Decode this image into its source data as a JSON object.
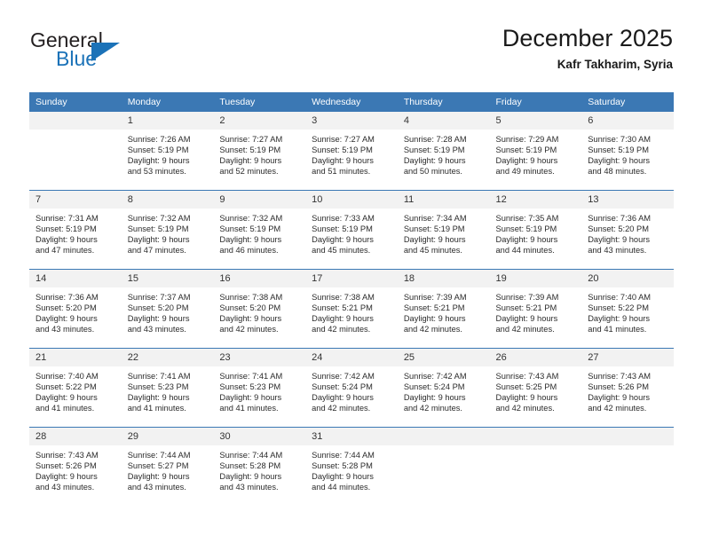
{
  "brand": {
    "name_top": "General",
    "name_bottom": "Blue",
    "accent_color": "#1b72b8",
    "triangle_icon": "triangle-icon"
  },
  "header": {
    "title": "December 2025",
    "subtitle": "Kafr Takharim, Syria"
  },
  "calendar": {
    "header_bg": "#3b78b4",
    "daynum_bg": "#f2f2f2",
    "weekdays": [
      "Sunday",
      "Monday",
      "Tuesday",
      "Wednesday",
      "Thursday",
      "Friday",
      "Saturday"
    ],
    "weeks": [
      [
        {
          "day": "",
          "blank": true,
          "sunrise": "",
          "sunset": "",
          "daylight1": "",
          "daylight2": ""
        },
        {
          "day": "1",
          "sunrise": "Sunrise: 7:26 AM",
          "sunset": "Sunset: 5:19 PM",
          "daylight1": "Daylight: 9 hours",
          "daylight2": "and 53 minutes."
        },
        {
          "day": "2",
          "sunrise": "Sunrise: 7:27 AM",
          "sunset": "Sunset: 5:19 PM",
          "daylight1": "Daylight: 9 hours",
          "daylight2": "and 52 minutes."
        },
        {
          "day": "3",
          "sunrise": "Sunrise: 7:27 AM",
          "sunset": "Sunset: 5:19 PM",
          "daylight1": "Daylight: 9 hours",
          "daylight2": "and 51 minutes."
        },
        {
          "day": "4",
          "sunrise": "Sunrise: 7:28 AM",
          "sunset": "Sunset: 5:19 PM",
          "daylight1": "Daylight: 9 hours",
          "daylight2": "and 50 minutes."
        },
        {
          "day": "5",
          "sunrise": "Sunrise: 7:29 AM",
          "sunset": "Sunset: 5:19 PM",
          "daylight1": "Daylight: 9 hours",
          "daylight2": "and 49 minutes."
        },
        {
          "day": "6",
          "sunrise": "Sunrise: 7:30 AM",
          "sunset": "Sunset: 5:19 PM",
          "daylight1": "Daylight: 9 hours",
          "daylight2": "and 48 minutes."
        }
      ],
      [
        {
          "day": "7",
          "sunrise": "Sunrise: 7:31 AM",
          "sunset": "Sunset: 5:19 PM",
          "daylight1": "Daylight: 9 hours",
          "daylight2": "and 47 minutes."
        },
        {
          "day": "8",
          "sunrise": "Sunrise: 7:32 AM",
          "sunset": "Sunset: 5:19 PM",
          "daylight1": "Daylight: 9 hours",
          "daylight2": "and 47 minutes."
        },
        {
          "day": "9",
          "sunrise": "Sunrise: 7:32 AM",
          "sunset": "Sunset: 5:19 PM",
          "daylight1": "Daylight: 9 hours",
          "daylight2": "and 46 minutes."
        },
        {
          "day": "10",
          "sunrise": "Sunrise: 7:33 AM",
          "sunset": "Sunset: 5:19 PM",
          "daylight1": "Daylight: 9 hours",
          "daylight2": "and 45 minutes."
        },
        {
          "day": "11",
          "sunrise": "Sunrise: 7:34 AM",
          "sunset": "Sunset: 5:19 PM",
          "daylight1": "Daylight: 9 hours",
          "daylight2": "and 45 minutes."
        },
        {
          "day": "12",
          "sunrise": "Sunrise: 7:35 AM",
          "sunset": "Sunset: 5:19 PM",
          "daylight1": "Daylight: 9 hours",
          "daylight2": "and 44 minutes."
        },
        {
          "day": "13",
          "sunrise": "Sunrise: 7:36 AM",
          "sunset": "Sunset: 5:20 PM",
          "daylight1": "Daylight: 9 hours",
          "daylight2": "and 43 minutes."
        }
      ],
      [
        {
          "day": "14",
          "sunrise": "Sunrise: 7:36 AM",
          "sunset": "Sunset: 5:20 PM",
          "daylight1": "Daylight: 9 hours",
          "daylight2": "and 43 minutes."
        },
        {
          "day": "15",
          "sunrise": "Sunrise: 7:37 AM",
          "sunset": "Sunset: 5:20 PM",
          "daylight1": "Daylight: 9 hours",
          "daylight2": "and 43 minutes."
        },
        {
          "day": "16",
          "sunrise": "Sunrise: 7:38 AM",
          "sunset": "Sunset: 5:20 PM",
          "daylight1": "Daylight: 9 hours",
          "daylight2": "and 42 minutes."
        },
        {
          "day": "17",
          "sunrise": "Sunrise: 7:38 AM",
          "sunset": "Sunset: 5:21 PM",
          "daylight1": "Daylight: 9 hours",
          "daylight2": "and 42 minutes."
        },
        {
          "day": "18",
          "sunrise": "Sunrise: 7:39 AM",
          "sunset": "Sunset: 5:21 PM",
          "daylight1": "Daylight: 9 hours",
          "daylight2": "and 42 minutes."
        },
        {
          "day": "19",
          "sunrise": "Sunrise: 7:39 AM",
          "sunset": "Sunset: 5:21 PM",
          "daylight1": "Daylight: 9 hours",
          "daylight2": "and 42 minutes."
        },
        {
          "day": "20",
          "sunrise": "Sunrise: 7:40 AM",
          "sunset": "Sunset: 5:22 PM",
          "daylight1": "Daylight: 9 hours",
          "daylight2": "and 41 minutes."
        }
      ],
      [
        {
          "day": "21",
          "sunrise": "Sunrise: 7:40 AM",
          "sunset": "Sunset: 5:22 PM",
          "daylight1": "Daylight: 9 hours",
          "daylight2": "and 41 minutes."
        },
        {
          "day": "22",
          "sunrise": "Sunrise: 7:41 AM",
          "sunset": "Sunset: 5:23 PM",
          "daylight1": "Daylight: 9 hours",
          "daylight2": "and 41 minutes."
        },
        {
          "day": "23",
          "sunrise": "Sunrise: 7:41 AM",
          "sunset": "Sunset: 5:23 PM",
          "daylight1": "Daylight: 9 hours",
          "daylight2": "and 41 minutes."
        },
        {
          "day": "24",
          "sunrise": "Sunrise: 7:42 AM",
          "sunset": "Sunset: 5:24 PM",
          "daylight1": "Daylight: 9 hours",
          "daylight2": "and 42 minutes."
        },
        {
          "day": "25",
          "sunrise": "Sunrise: 7:42 AM",
          "sunset": "Sunset: 5:24 PM",
          "daylight1": "Daylight: 9 hours",
          "daylight2": "and 42 minutes."
        },
        {
          "day": "26",
          "sunrise": "Sunrise: 7:43 AM",
          "sunset": "Sunset: 5:25 PM",
          "daylight1": "Daylight: 9 hours",
          "daylight2": "and 42 minutes."
        },
        {
          "day": "27",
          "sunrise": "Sunrise: 7:43 AM",
          "sunset": "Sunset: 5:26 PM",
          "daylight1": "Daylight: 9 hours",
          "daylight2": "and 42 minutes."
        }
      ],
      [
        {
          "day": "28",
          "sunrise": "Sunrise: 7:43 AM",
          "sunset": "Sunset: 5:26 PM",
          "daylight1": "Daylight: 9 hours",
          "daylight2": "and 43 minutes."
        },
        {
          "day": "29",
          "sunrise": "Sunrise: 7:44 AM",
          "sunset": "Sunset: 5:27 PM",
          "daylight1": "Daylight: 9 hours",
          "daylight2": "and 43 minutes."
        },
        {
          "day": "30",
          "sunrise": "Sunrise: 7:44 AM",
          "sunset": "Sunset: 5:28 PM",
          "daylight1": "Daylight: 9 hours",
          "daylight2": "and 43 minutes."
        },
        {
          "day": "31",
          "sunrise": "Sunrise: 7:44 AM",
          "sunset": "Sunset: 5:28 PM",
          "daylight1": "Daylight: 9 hours",
          "daylight2": "and 44 minutes."
        },
        {
          "day": "",
          "blank": true,
          "sunrise": "",
          "sunset": "",
          "daylight1": "",
          "daylight2": ""
        },
        {
          "day": "",
          "blank": true,
          "sunrise": "",
          "sunset": "",
          "daylight1": "",
          "daylight2": ""
        },
        {
          "day": "",
          "blank": true,
          "sunrise": "",
          "sunset": "",
          "daylight1": "",
          "daylight2": ""
        }
      ]
    ]
  }
}
